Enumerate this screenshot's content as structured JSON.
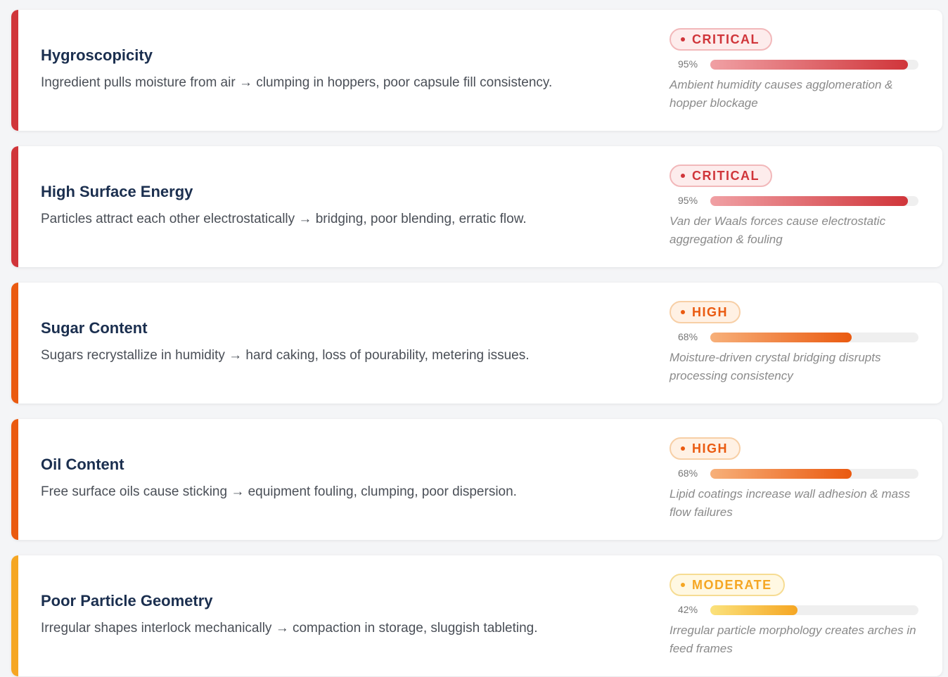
{
  "colors": {
    "critical": "#d0353a",
    "high": "#ea5a10",
    "moderate": "#f5a623"
  },
  "cards": [
    {
      "title": "Hygroscopicity",
      "description": "Ingredient pulls moisture from air → clumping in hoppers, poor capsule fill consistency.",
      "severity": "CRITICAL",
      "level": "critical",
      "percent": 95,
      "percent_label": "95%",
      "note": "Ambient humidity causes agglomeration & hopper blockage"
    },
    {
      "title": "High Surface Energy",
      "description": "Particles attract each other electrostatically → bridging, poor blending, erratic flow.",
      "severity": "CRITICAL",
      "level": "critical",
      "percent": 95,
      "percent_label": "95%",
      "note": "Van der Waals forces cause electrostatic aggregation & fouling"
    },
    {
      "title": "Sugar Content",
      "description": "Sugars recrystallize in humidity → hard caking, loss of pourability, metering issues.",
      "severity": "HIGH",
      "level": "high",
      "percent": 68,
      "percent_label": "68%",
      "note": "Moisture-driven crystal bridging disrupts processing consistency"
    },
    {
      "title": "Oil Content",
      "description": "Free surface oils cause sticking → equipment fouling, clumping, poor dispersion.",
      "severity": "HIGH",
      "level": "high",
      "percent": 68,
      "percent_label": "68%",
      "note": "Lipid coatings increase wall adhesion & mass flow failures"
    },
    {
      "title": "Poor Particle Geometry",
      "description": "Irregular shapes interlock mechanically → compaction in storage, sluggish tableting.",
      "severity": "MODERATE",
      "level": "moderate",
      "percent": 42,
      "percent_label": "42%",
      "note": "Irregular particle morphology creates arches in feed frames"
    }
  ]
}
